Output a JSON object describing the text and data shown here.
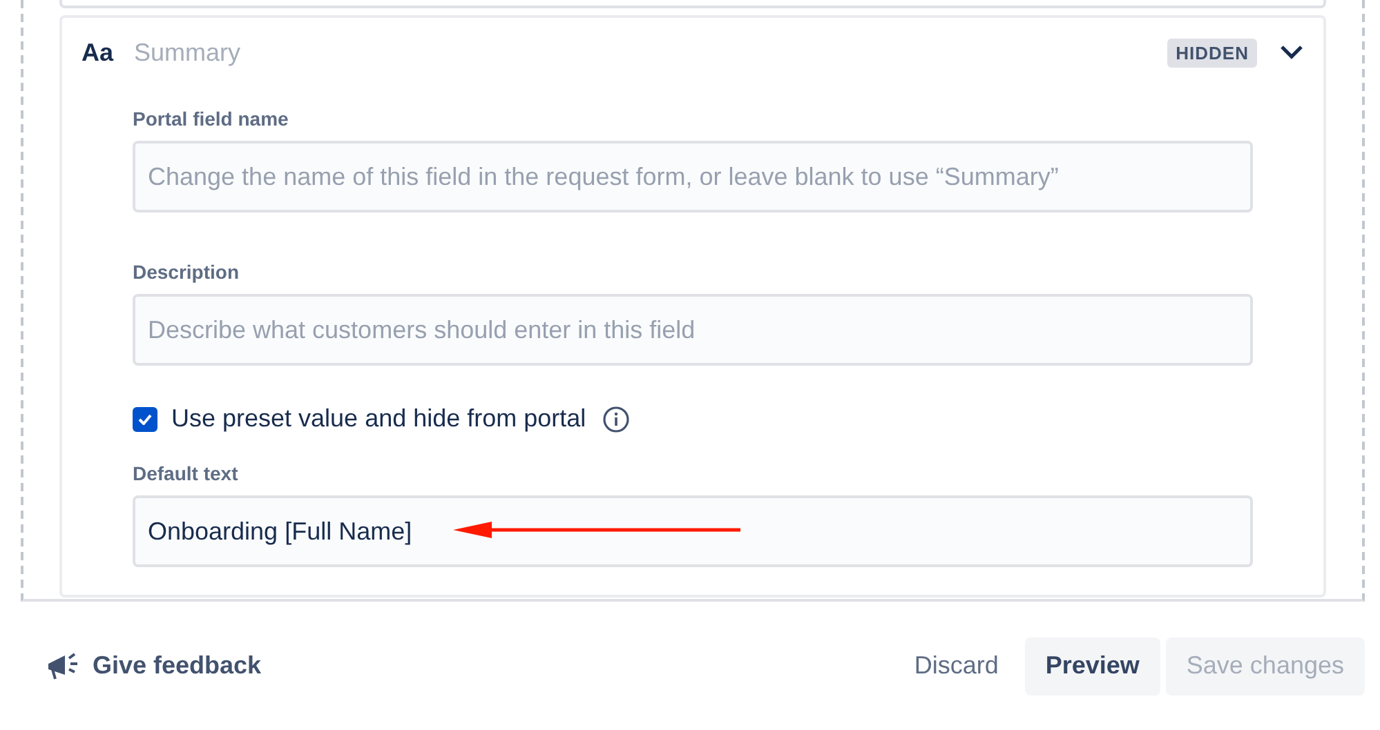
{
  "field_card": {
    "type_icon": "Aa",
    "title": "Summary",
    "badge": "HIDDEN",
    "expanded": true,
    "fields": [
      {
        "kind": "text",
        "label": "Portal field name",
        "placeholder": "Change the name of this field in the request form, or leave blank to use “Summary”"
      },
      {
        "kind": "text",
        "label": "Description",
        "placeholder": "Describe what customers should enter in this field"
      },
      {
        "kind": "checkbox",
        "label": "Use preset value and hide from portal",
        "checked": true
      },
      {
        "kind": "text",
        "label": "Default text",
        "value": "Onboarding [Full Name]",
        "annotated": true
      }
    ]
  },
  "footer": {
    "feedback": "Give feedback",
    "buttons": [
      {
        "label": "Discard",
        "kind": "subtle",
        "disabled": false
      },
      {
        "label": "Preview",
        "kind": "default",
        "disabled": false
      },
      {
        "label": "Save changes",
        "kind": "primary",
        "disabled": true
      }
    ]
  }
}
